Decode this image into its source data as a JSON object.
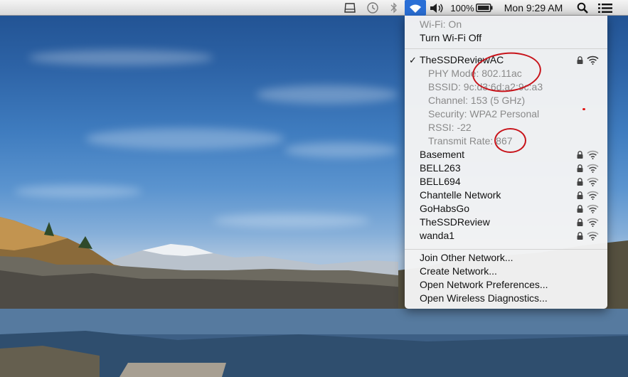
{
  "menubar": {
    "battery_percent": "100%",
    "clock": "Mon 9:29 AM",
    "icons": [
      "clipboard-icon",
      "time-machine-icon",
      "bluetooth-icon",
      "wifi-icon",
      "volume-icon",
      "battery-icon",
      "spotlight-search-icon",
      "notification-list-icon"
    ]
  },
  "wifi_menu": {
    "status": "Wi-Fi: On",
    "toggle": "Turn Wi-Fi Off",
    "connected": {
      "name": "TheSSDReviewAC",
      "phy": "PHY Mode: 802.11ac",
      "bssid": "BSSID: 9c:d3:6d:a2:9c:a3",
      "channel": "Channel: 153 (5 GHz)",
      "security": "Security: WPA2 Personal",
      "rssi": "RSSI: -22",
      "rate": "Transmit Rate: 867"
    },
    "networks": [
      {
        "name": "Basement"
      },
      {
        "name": "BELL263"
      },
      {
        "name": "BELL694"
      },
      {
        "name": "Chantelle Network"
      },
      {
        "name": "GoHabsGo"
      },
      {
        "name": "TheSSDReview"
      },
      {
        "name": "wanda1"
      }
    ],
    "actions": {
      "join": "Join Other Network...",
      "create": "Create Network...",
      "prefs": "Open Network Preferences...",
      "diag": "Open Wireless Diagnostics..."
    }
  },
  "colors": {
    "highlight": "#2a6fd6",
    "annotation": "#c8141b"
  }
}
